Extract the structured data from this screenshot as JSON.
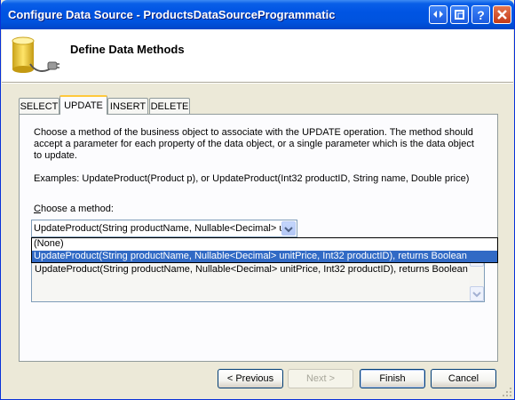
{
  "window": {
    "title": "Configure Data Source - ProductsDataSourceProgrammatic"
  },
  "header": {
    "title": "Define Data Methods"
  },
  "tabs": [
    {
      "label": "SELECT"
    },
    {
      "label": "UPDATE"
    },
    {
      "label": "INSERT"
    },
    {
      "label": "DELETE"
    }
  ],
  "panel": {
    "description_line1": "Choose a method of the business object to associate with the UPDATE operation. The method should",
    "description_line2": "accept a parameter for each property of the data object, or a single parameter which is the data object",
    "description_line3": "to update.",
    "examples": "Examples: UpdateProduct(Product p), or UpdateProduct(Int32 productID, String name, Double price)",
    "choose_label": "Choose a method:",
    "choose_mnemonic": "C",
    "choose_rest": "hoose a method:",
    "combo_value": "UpdateProduct(String productName, Nullable<Decimal> u",
    "dropdown_options": [
      "(None)",
      "UpdateProduct(String productName, Nullable<Decimal> unitPrice, Int32 productID), returns Boolean"
    ],
    "selected_index": 1,
    "signature_text": "UpdateProduct(String productName, Nullable<Decimal> unitPrice, Int32 productID), returns Boolean"
  },
  "buttons": {
    "previous": "< Previous",
    "next": "Next >",
    "finish": "Finish",
    "cancel": "Cancel"
  },
  "colors": {
    "titlebar": "#0054e3",
    "selection": "#316ac5",
    "active_tab_accent": "#ffc83c",
    "dialog_bg": "#ece9d8"
  }
}
